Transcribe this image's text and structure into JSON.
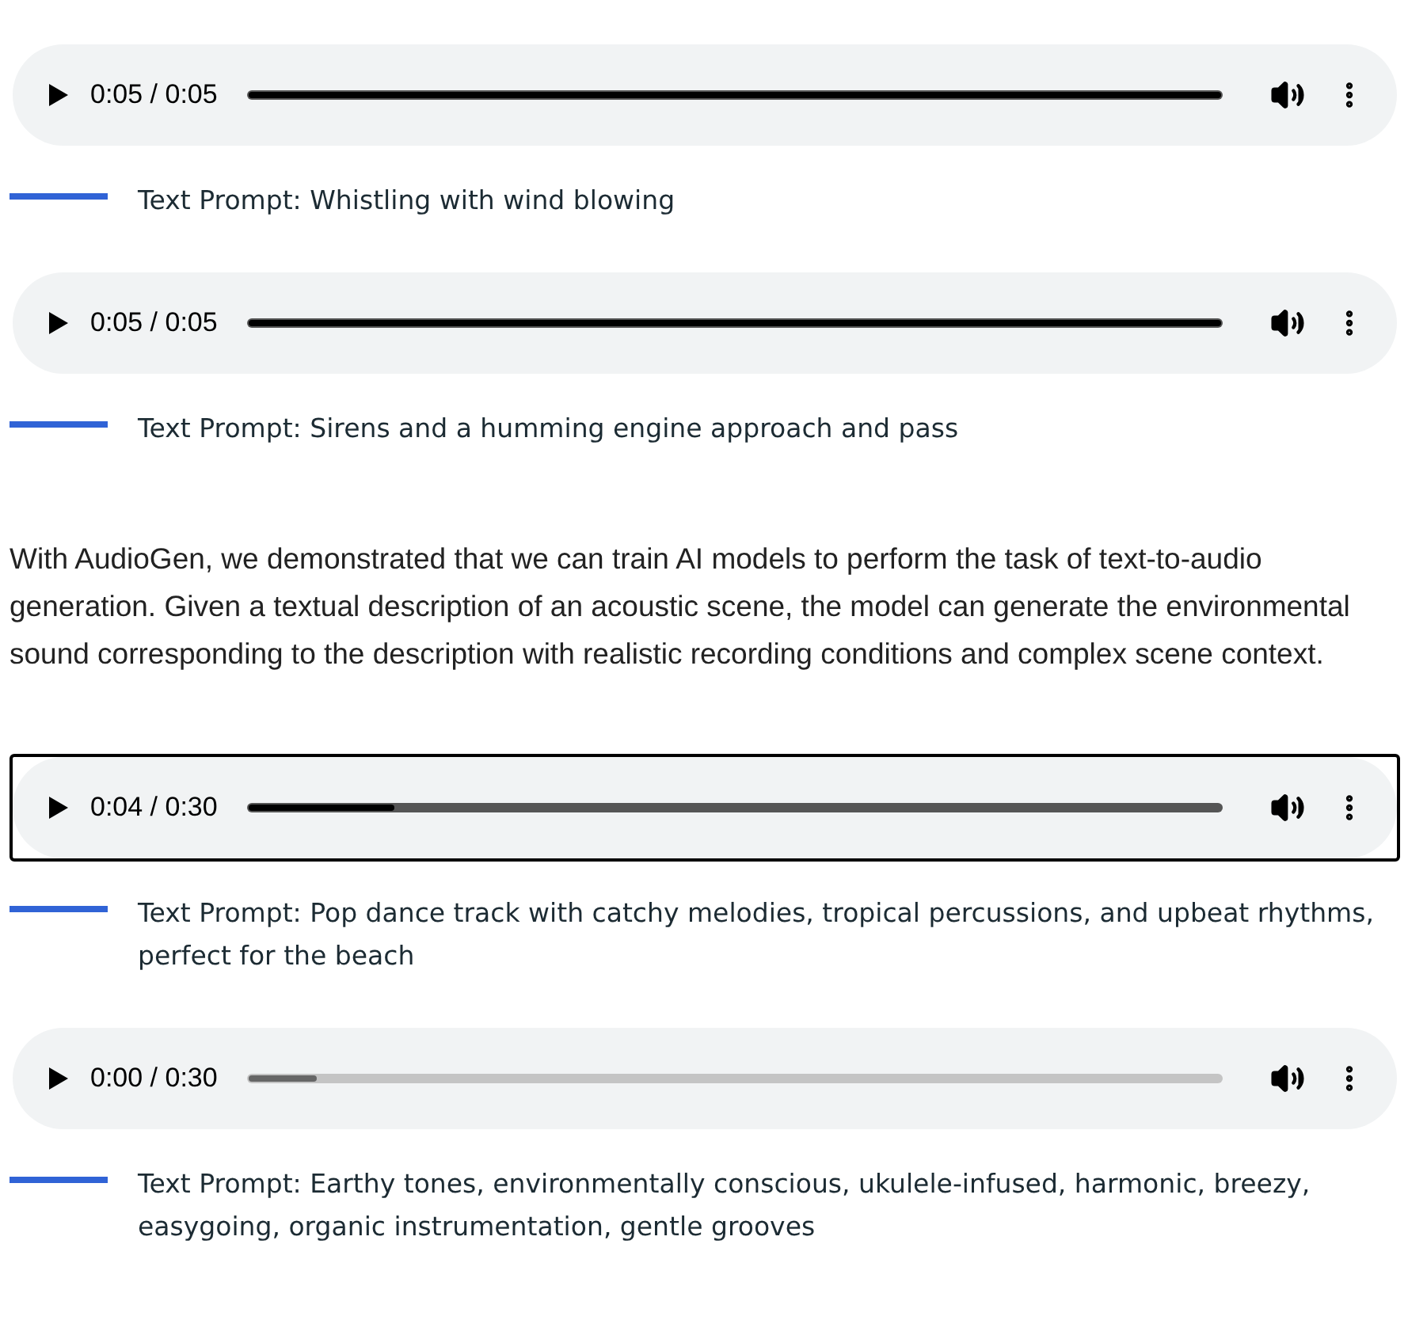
{
  "sections": [
    {
      "kind": "player",
      "time": "0:05 / 0:05",
      "level": 1,
      "loaded": true,
      "focused": false
    },
    {
      "kind": "caption",
      "text": "Text Prompt: Whistling with wind blowing"
    },
    {
      "kind": "player",
      "time": "0:05 / 0:05",
      "level": 1,
      "loaded": true,
      "focused": false
    },
    {
      "kind": "caption",
      "text": "Text Prompt: Sirens and a humming engine approach and pass"
    },
    {
      "kind": "paragraph",
      "text": "With AudioGen, we demonstrated that we can train AI models to perform the task of text-to-audio generation. Given a textual description of an acoustic scene, the model can generate the environmental sound corresponding to the description with realistic recording conditions and complex scene context."
    },
    {
      "kind": "player",
      "time": "0:04 / 0:30",
      "level": 0.15,
      "loaded": true,
      "focused": true
    },
    {
      "kind": "caption",
      "text": "Text Prompt: Pop dance track with catchy melodies, tropical percussions, and upbeat rhythms, perfect for the beach"
    },
    {
      "kind": "player",
      "time": "0:00 / 0:30",
      "level": 0.07,
      "loaded": false,
      "focused": false
    },
    {
      "kind": "caption",
      "text": "Text Prompt: Earthy tones, environmentally conscious, ukulele-infused, harmonic, breezy, easygoing, organic instrumentation, gentle grooves"
    }
  ]
}
